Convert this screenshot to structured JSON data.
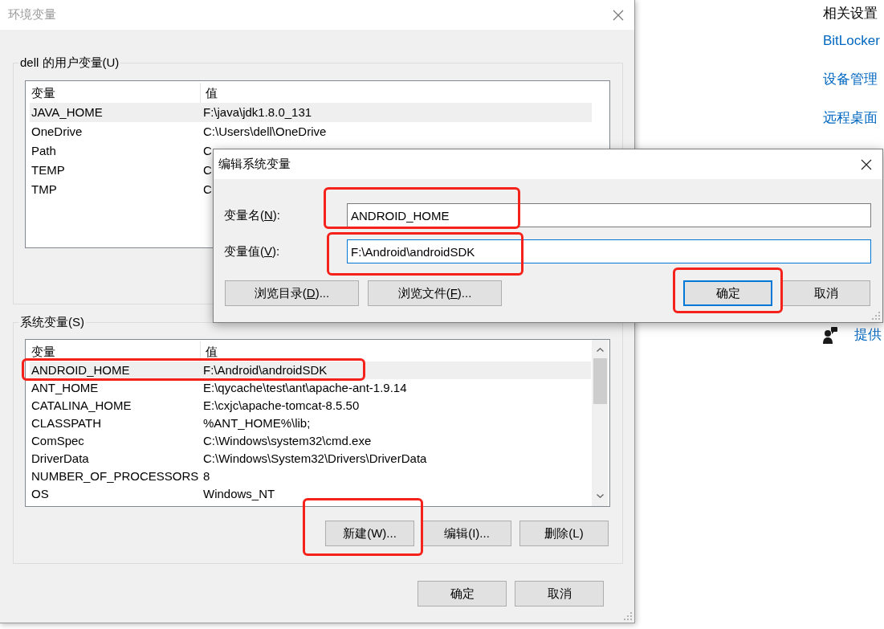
{
  "environment_window": {
    "title": "环境变量",
    "user_variables": {
      "title": "dell 的用户变量(U)",
      "columns": [
        "变量",
        "值"
      ],
      "rows": [
        {
          "name": "JAVA_HOME",
          "value": "F:\\java\\jdk1.8.0_131",
          "selected": true
        },
        {
          "name": "OneDrive",
          "value": "C:\\Users\\dell\\OneDrive",
          "selected": false
        },
        {
          "name": "Path",
          "value": "C",
          "selected": false
        },
        {
          "name": "TEMP",
          "value": "C",
          "selected": false
        },
        {
          "name": "TMP",
          "value": "C",
          "selected": false
        }
      ]
    },
    "system_variables": {
      "title": "系统变量(S)",
      "columns": [
        "变量",
        "值"
      ],
      "rows": [
        {
          "name": "ANDROID_HOME",
          "value": "F:\\Android\\androidSDK",
          "selected": true,
          "highlighted": true
        },
        {
          "name": "ANT_HOME",
          "value": "E:\\qycache\\test\\ant\\apache-ant-1.9.14",
          "selected": false,
          "highlighted": false
        },
        {
          "name": "CATALINA_HOME",
          "value": "E:\\cxjc\\apache-tomcat-8.5.50",
          "selected": false,
          "highlighted": false
        },
        {
          "name": "CLASSPATH",
          "value": "%ANT_HOME%\\lib;",
          "selected": false,
          "highlighted": false
        },
        {
          "name": "ComSpec",
          "value": "C:\\Windows\\system32\\cmd.exe",
          "selected": false,
          "highlighted": false
        },
        {
          "name": "DriverData",
          "value": "C:\\Windows\\System32\\Drivers\\DriverData",
          "selected": false,
          "highlighted": false
        },
        {
          "name": "NUMBER_OF_PROCESSORS",
          "value": "8",
          "selected": false,
          "highlighted": false
        },
        {
          "name": "OS",
          "value": "Windows_NT",
          "selected": false,
          "highlighted": false
        }
      ],
      "buttons": [
        {
          "label": "新建(W)...",
          "highlighted": true
        },
        {
          "label": "编辑(I)...",
          "highlighted": false
        },
        {
          "label": "删除(L)",
          "highlighted": false
        }
      ]
    },
    "buttons": [
      "确定",
      "取消"
    ]
  },
  "edit_dialog": {
    "title": "编辑系统变量",
    "fields": [
      {
        "label_parts": [
          "变量名(",
          "N",
          "):"
        ],
        "value": "ANDROID_HOME",
        "focused": false,
        "highlighted": true
      },
      {
        "label_parts": [
          "变量值(",
          "V",
          "):"
        ],
        "value": "F:\\Android\\androidSDK",
        "focused": true,
        "highlighted": true
      }
    ],
    "browse_buttons": [
      {
        "label_parts": [
          "浏览目录(",
          "D",
          ")..."
        ]
      },
      {
        "label_parts": [
          "浏览文件(",
          "F",
          ")..."
        ]
      }
    ],
    "buttons": [
      {
        "label_parts": [
          "确定"
        ],
        "default": true,
        "highlighted": true
      },
      {
        "label_parts": [
          "取消"
        ],
        "default": false,
        "highlighted": false
      }
    ]
  },
  "related_settings": {
    "title": "相关设置",
    "links": [
      "BitLocker",
      "设备管理",
      "远程桌面"
    ],
    "feedback_link": "提供"
  }
}
